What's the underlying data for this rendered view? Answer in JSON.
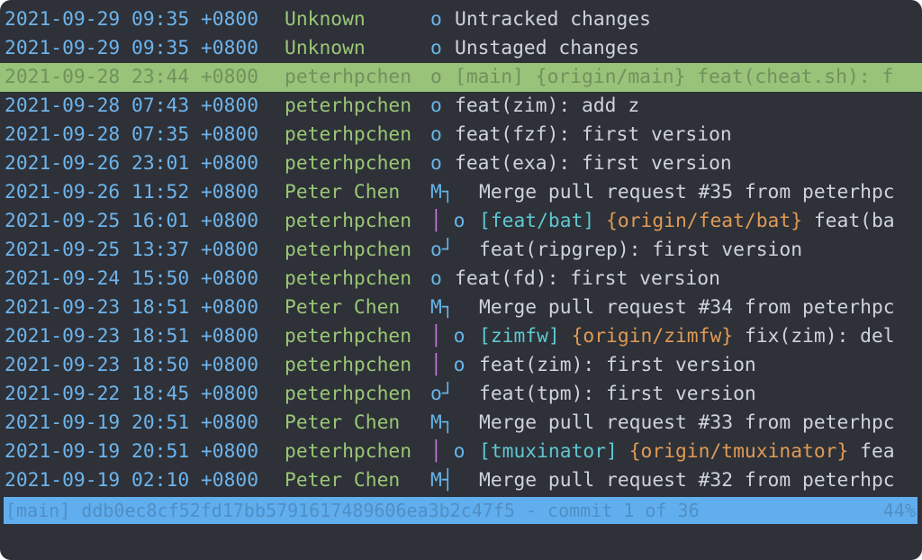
{
  "rows": [
    {
      "date": "2021-09-29 09:35 +0800",
      "author": "Unknown",
      "graph": "o",
      "graph_bar": "",
      "refs_local": "",
      "refs_remote": "",
      "subject": "Untracked changes",
      "shift": false,
      "selected": false
    },
    {
      "date": "2021-09-29 09:35 +0800",
      "author": "Unknown",
      "graph": "o",
      "graph_bar": "",
      "refs_local": "",
      "refs_remote": "",
      "subject": "Unstaged changes",
      "shift": false,
      "selected": false
    },
    {
      "date": "2021-09-28 23:44 +0800",
      "author": "peterhpchen",
      "graph": "o",
      "graph_bar": "",
      "refs_local": "[main]",
      "refs_remote": "{origin/main}",
      "subject": "feat(cheat.sh): f",
      "shift": false,
      "selected": true
    },
    {
      "date": "2021-09-28 07:43 +0800",
      "author": "peterhpchen",
      "graph": "o",
      "graph_bar": "",
      "refs_local": "",
      "refs_remote": "",
      "subject": "feat(zim): add z",
      "shift": false,
      "selected": false
    },
    {
      "date": "2021-09-28 07:35 +0800",
      "author": "peterhpchen",
      "graph": "o",
      "graph_bar": "",
      "refs_local": "",
      "refs_remote": "",
      "subject": "feat(fzf): first version",
      "shift": false,
      "selected": false
    },
    {
      "date": "2021-09-26 23:01 +0800",
      "author": "peterhpchen",
      "graph": "o",
      "graph_bar": "",
      "refs_local": "",
      "refs_remote": "",
      "subject": "feat(exa): first version",
      "shift": false,
      "selected": false
    },
    {
      "date": "2021-09-26 11:52 +0800",
      "author": "Peter Chen",
      "graph": "M┐",
      "graph_bar": "",
      "refs_local": "",
      "refs_remote": "",
      "subject": "Merge pull request #35 from peterhpc",
      "shift": true,
      "selected": false
    },
    {
      "date": "2021-09-25 16:01 +0800",
      "author": "peterhpchen",
      "graph": " o",
      "graph_bar": "│",
      "refs_local": "[feat/bat]",
      "refs_remote": "{origin/feat/bat}",
      "subject": "feat(ba",
      "shift": true,
      "selected": false
    },
    {
      "date": "2021-09-25 13:37 +0800",
      "author": "peterhpchen",
      "graph": "o┘",
      "graph_bar": "",
      "refs_local": "",
      "refs_remote": "",
      "subject": "feat(ripgrep): first version",
      "shift": true,
      "selected": false
    },
    {
      "date": "2021-09-24 15:50 +0800",
      "author": "peterhpchen",
      "graph": "o",
      "graph_bar": "",
      "refs_local": "",
      "refs_remote": "",
      "subject": "feat(fd): first version",
      "shift": false,
      "selected": false
    },
    {
      "date": "2021-09-23 18:51 +0800",
      "author": "Peter Chen",
      "graph": "M┐",
      "graph_bar": "",
      "refs_local": "",
      "refs_remote": "",
      "subject": "Merge pull request #34 from peterhpc",
      "shift": true,
      "selected": false
    },
    {
      "date": "2021-09-23 18:51 +0800",
      "author": "peterhpchen",
      "graph": " o",
      "graph_bar": "│",
      "refs_local": "[zimfw]",
      "refs_remote": "{origin/zimfw}",
      "subject": "fix(zim): del",
      "shift": true,
      "selected": false
    },
    {
      "date": "2021-09-23 18:50 +0800",
      "author": "peterhpchen",
      "graph": " o",
      "graph_bar": "│",
      "refs_local": "",
      "refs_remote": "",
      "subject": "feat(zim): first version",
      "shift": true,
      "selected": false
    },
    {
      "date": "2021-09-22 18:45 +0800",
      "author": "peterhpchen",
      "graph": "o┘",
      "graph_bar": "",
      "refs_local": "",
      "refs_remote": "",
      "subject": "feat(tpm): first version",
      "shift": true,
      "selected": false
    },
    {
      "date": "2021-09-19 20:51 +0800",
      "author": "Peter Chen",
      "graph": "M┐",
      "graph_bar": "",
      "refs_local": "",
      "refs_remote": "",
      "subject": "Merge pull request #33 from peterhpc",
      "shift": true,
      "selected": false
    },
    {
      "date": "2021-09-19 20:51 +0800",
      "author": "peterhpchen",
      "graph": " o",
      "graph_bar": "│",
      "refs_local": "[tmuxinator]",
      "refs_remote": "{origin/tmuxinator}",
      "subject": "fea",
      "shift": true,
      "selected": false
    },
    {
      "date": "2021-09-19 02:10 +0800",
      "author": "Peter Chen",
      "graph": "M┤",
      "graph_bar": "",
      "refs_local": "",
      "refs_remote": "",
      "subject": "Merge pull request #32 from peterhpc",
      "shift": true,
      "selected": false
    }
  ],
  "status": {
    "text": "[main] ddb0ec8cf52fd17bb5791617489606ea3b2c47f5 - commit 1 of 36",
    "percent": "44%"
  },
  "colors": {
    "background": "#2e3138",
    "date": "#6eb4ec",
    "author": "#9ac776",
    "local_ref": "#5fc7d0",
    "remote_ref": "#e09a55",
    "graph_bar": "#c678dd",
    "selection": "#98c379",
    "status_bar": "#61aeee"
  }
}
